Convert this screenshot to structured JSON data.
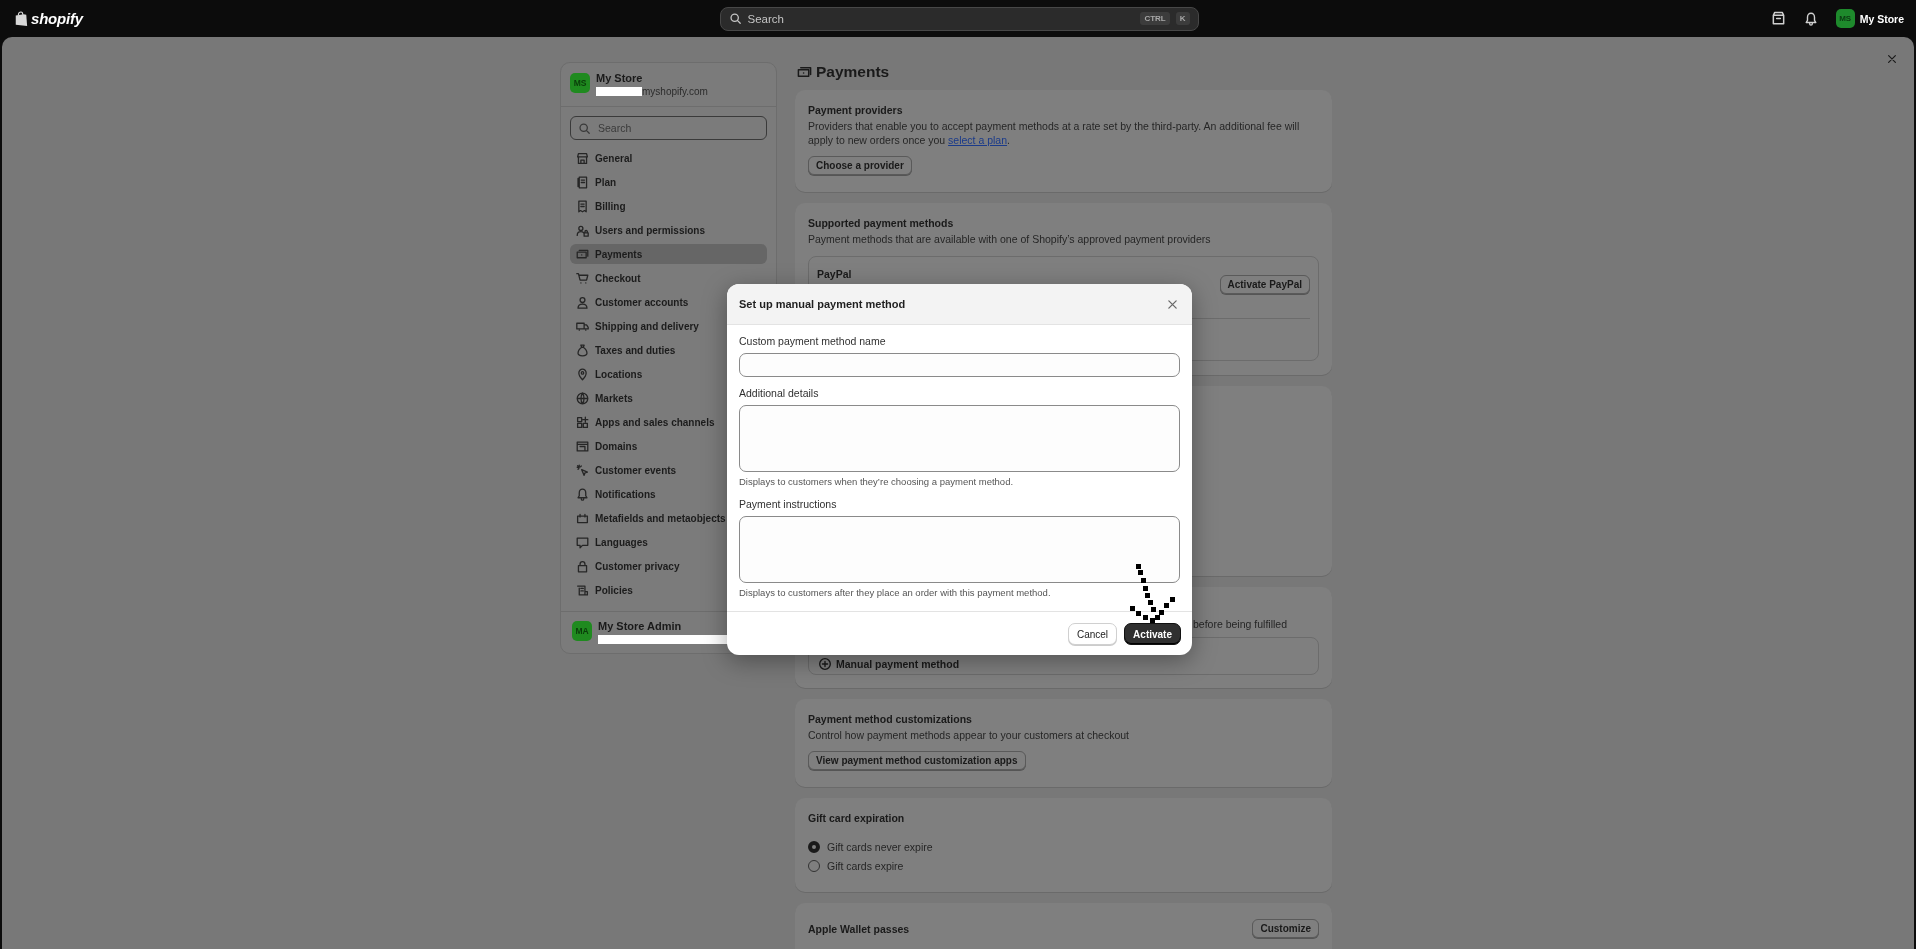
{
  "top_bar": {
    "logo": "shopify",
    "search": {
      "placeholder": "Search",
      "shortcut": [
        "CTRL",
        "K"
      ]
    },
    "account": {
      "initials": "MS",
      "name": "My Store"
    }
  },
  "sidebar": {
    "store": {
      "initials": "MS",
      "name": "My Store",
      "domain": "myshopify.com"
    },
    "search": {
      "placeholder": "Search"
    },
    "items": [
      {
        "label": "General",
        "selected": false
      },
      {
        "label": "Plan",
        "selected": false
      },
      {
        "label": "Billing",
        "selected": false
      },
      {
        "label": "Users and permissions",
        "selected": false
      },
      {
        "label": "Payments",
        "selected": true
      },
      {
        "label": "Checkout",
        "selected": false
      },
      {
        "label": "Customer accounts",
        "selected": false
      },
      {
        "label": "Shipping and delivery",
        "selected": false
      },
      {
        "label": "Taxes and duties",
        "selected": false
      },
      {
        "label": "Locations",
        "selected": false
      },
      {
        "label": "Markets",
        "selected": false
      },
      {
        "label": "Apps and sales channels",
        "selected": false
      },
      {
        "label": "Domains",
        "selected": false
      },
      {
        "label": "Customer events",
        "selected": false
      },
      {
        "label": "Notifications",
        "selected": false
      },
      {
        "label": "Metafields and metaobjects",
        "selected": false
      },
      {
        "label": "Languages",
        "selected": false
      },
      {
        "label": "Customer privacy",
        "selected": false
      },
      {
        "label": "Policies",
        "selected": false
      }
    ],
    "footer": {
      "initials": "MA",
      "name": "My Store Admin"
    }
  },
  "page": {
    "title": "Payments",
    "cards": [
      {
        "kind": "section",
        "title": "Payment providers",
        "description": "Providers that enable you to accept payment methods at a rate set by the third-party. An additional fee will apply to new orders once you ",
        "link": "select a plan",
        "description_end": ".",
        "button": "Choose a provider"
      },
      {
        "kind": "methods",
        "title": "Supported payment methods",
        "description": "Payment methods that are available with one of Shopify’s approved payment providers",
        "methods": [
          {
            "name": "PayPal",
            "button": "Activate PayPal"
          }
        ]
      },
      {
        "kind": "covered"
      },
      {
        "kind": "manual",
        "description": "before being fulfilled",
        "button": "Manual payment method"
      },
      {
        "kind": "section",
        "title": "Payment method customizations",
        "description": "Control how payment methods appear to your customers at checkout",
        "button": "View payment method customization apps"
      },
      {
        "kind": "radio",
        "title": "Gift card expiration",
        "options": [
          {
            "label": "Gift cards never expire",
            "selected": true
          },
          {
            "label": "Gift cards expire",
            "selected": false
          }
        ]
      },
      {
        "kind": "header_button",
        "title": "Apple Wallet passes",
        "button": "Customize"
      }
    ]
  },
  "modal": {
    "title": "Set up manual payment method",
    "fields": [
      {
        "kind": "input",
        "label": "Custom payment method name"
      },
      {
        "kind": "textarea",
        "label": "Additional details",
        "help": "Displays to customers when they’re choosing a payment method."
      },
      {
        "kind": "textarea",
        "label": "Payment instructions",
        "help": "Displays to customers after they place an order with this payment method."
      }
    ],
    "buttons": [
      {
        "kind": "secondary",
        "label": "Cancel"
      },
      {
        "kind": "primary",
        "label": "Activate"
      }
    ]
  }
}
